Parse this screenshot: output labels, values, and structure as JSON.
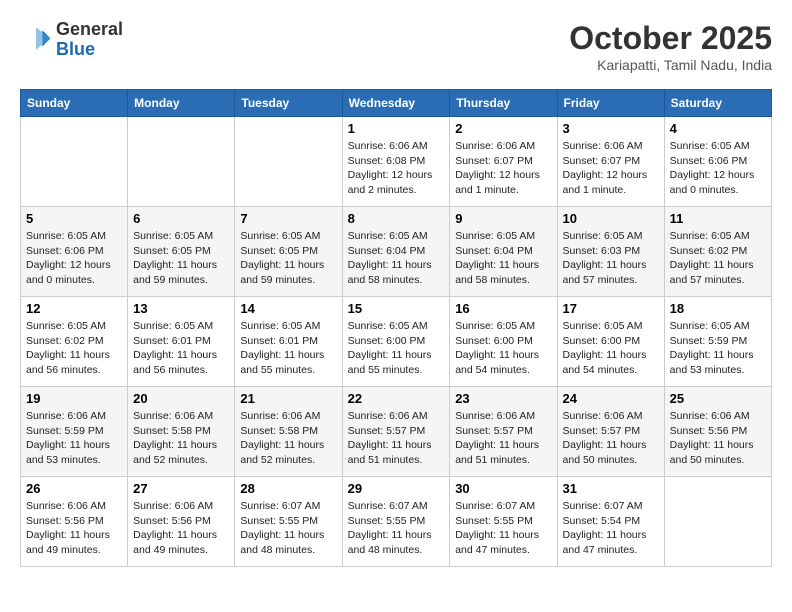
{
  "logo": {
    "line1": "General",
    "line2": "Blue"
  },
  "header": {
    "month": "October 2025",
    "location": "Kariapatti, Tamil Nadu, India"
  },
  "weekdays": [
    "Sunday",
    "Monday",
    "Tuesday",
    "Wednesday",
    "Thursday",
    "Friday",
    "Saturday"
  ],
  "weeks": [
    [
      {
        "day": "",
        "info": ""
      },
      {
        "day": "",
        "info": ""
      },
      {
        "day": "",
        "info": ""
      },
      {
        "day": "1",
        "info": "Sunrise: 6:06 AM\nSunset: 6:08 PM\nDaylight: 12 hours and 2 minutes."
      },
      {
        "day": "2",
        "info": "Sunrise: 6:06 AM\nSunset: 6:07 PM\nDaylight: 12 hours and 1 minute."
      },
      {
        "day": "3",
        "info": "Sunrise: 6:06 AM\nSunset: 6:07 PM\nDaylight: 12 hours and 1 minute."
      },
      {
        "day": "4",
        "info": "Sunrise: 6:05 AM\nSunset: 6:06 PM\nDaylight: 12 hours and 0 minutes."
      }
    ],
    [
      {
        "day": "5",
        "info": "Sunrise: 6:05 AM\nSunset: 6:06 PM\nDaylight: 12 hours and 0 minutes."
      },
      {
        "day": "6",
        "info": "Sunrise: 6:05 AM\nSunset: 6:05 PM\nDaylight: 11 hours and 59 minutes."
      },
      {
        "day": "7",
        "info": "Sunrise: 6:05 AM\nSunset: 6:05 PM\nDaylight: 11 hours and 59 minutes."
      },
      {
        "day": "8",
        "info": "Sunrise: 6:05 AM\nSunset: 6:04 PM\nDaylight: 11 hours and 58 minutes."
      },
      {
        "day": "9",
        "info": "Sunrise: 6:05 AM\nSunset: 6:04 PM\nDaylight: 11 hours and 58 minutes."
      },
      {
        "day": "10",
        "info": "Sunrise: 6:05 AM\nSunset: 6:03 PM\nDaylight: 11 hours and 57 minutes."
      },
      {
        "day": "11",
        "info": "Sunrise: 6:05 AM\nSunset: 6:02 PM\nDaylight: 11 hours and 57 minutes."
      }
    ],
    [
      {
        "day": "12",
        "info": "Sunrise: 6:05 AM\nSunset: 6:02 PM\nDaylight: 11 hours and 56 minutes."
      },
      {
        "day": "13",
        "info": "Sunrise: 6:05 AM\nSunset: 6:01 PM\nDaylight: 11 hours and 56 minutes."
      },
      {
        "day": "14",
        "info": "Sunrise: 6:05 AM\nSunset: 6:01 PM\nDaylight: 11 hours and 55 minutes."
      },
      {
        "day": "15",
        "info": "Sunrise: 6:05 AM\nSunset: 6:00 PM\nDaylight: 11 hours and 55 minutes."
      },
      {
        "day": "16",
        "info": "Sunrise: 6:05 AM\nSunset: 6:00 PM\nDaylight: 11 hours and 54 minutes."
      },
      {
        "day": "17",
        "info": "Sunrise: 6:05 AM\nSunset: 6:00 PM\nDaylight: 11 hours and 54 minutes."
      },
      {
        "day": "18",
        "info": "Sunrise: 6:05 AM\nSunset: 5:59 PM\nDaylight: 11 hours and 53 minutes."
      }
    ],
    [
      {
        "day": "19",
        "info": "Sunrise: 6:06 AM\nSunset: 5:59 PM\nDaylight: 11 hours and 53 minutes."
      },
      {
        "day": "20",
        "info": "Sunrise: 6:06 AM\nSunset: 5:58 PM\nDaylight: 11 hours and 52 minutes."
      },
      {
        "day": "21",
        "info": "Sunrise: 6:06 AM\nSunset: 5:58 PM\nDaylight: 11 hours and 52 minutes."
      },
      {
        "day": "22",
        "info": "Sunrise: 6:06 AM\nSunset: 5:57 PM\nDaylight: 11 hours and 51 minutes."
      },
      {
        "day": "23",
        "info": "Sunrise: 6:06 AM\nSunset: 5:57 PM\nDaylight: 11 hours and 51 minutes."
      },
      {
        "day": "24",
        "info": "Sunrise: 6:06 AM\nSunset: 5:57 PM\nDaylight: 11 hours and 50 minutes."
      },
      {
        "day": "25",
        "info": "Sunrise: 6:06 AM\nSunset: 5:56 PM\nDaylight: 11 hours and 50 minutes."
      }
    ],
    [
      {
        "day": "26",
        "info": "Sunrise: 6:06 AM\nSunset: 5:56 PM\nDaylight: 11 hours and 49 minutes."
      },
      {
        "day": "27",
        "info": "Sunrise: 6:06 AM\nSunset: 5:56 PM\nDaylight: 11 hours and 49 minutes."
      },
      {
        "day": "28",
        "info": "Sunrise: 6:07 AM\nSunset: 5:55 PM\nDaylight: 11 hours and 48 minutes."
      },
      {
        "day": "29",
        "info": "Sunrise: 6:07 AM\nSunset: 5:55 PM\nDaylight: 11 hours and 48 minutes."
      },
      {
        "day": "30",
        "info": "Sunrise: 6:07 AM\nSunset: 5:55 PM\nDaylight: 11 hours and 47 minutes."
      },
      {
        "day": "31",
        "info": "Sunrise: 6:07 AM\nSunset: 5:54 PM\nDaylight: 11 hours and 47 minutes."
      },
      {
        "day": "",
        "info": ""
      }
    ]
  ]
}
